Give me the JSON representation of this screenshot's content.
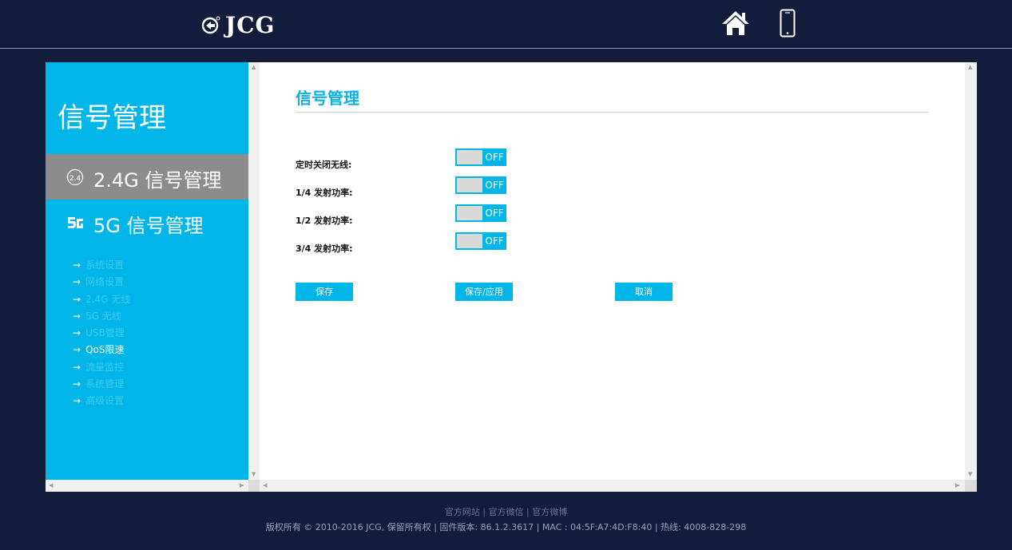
{
  "header": {
    "logo_text": "JCG",
    "logo_mark_icon": "jcg-compass-mark-icon",
    "home_icon": "home-icon",
    "phone_icon": "phone-icon"
  },
  "colors": {
    "background": "#111d3a",
    "accent": "#00b6e8",
    "sidebar_selected": "#8c8c8c",
    "toggle_off_knob": "#d9d9d9"
  },
  "sidebar": {
    "title": "信号管理",
    "item_24g": {
      "label": "2.4G 信号管理",
      "icon": "wifi-24-icon"
    },
    "item_5g": {
      "label": "5G 信号管理",
      "icon": "wifi-5g-icon"
    },
    "menu_arrow": "→",
    "menu": [
      {
        "label": "系统设置"
      },
      {
        "label": "网络设置"
      },
      {
        "label": "2.4G 无线"
      },
      {
        "label": "5G 无线"
      },
      {
        "label": "USB管理"
      },
      {
        "label": "QoS限速"
      },
      {
        "label": "流量监控"
      },
      {
        "label": "系统管理"
      },
      {
        "label": "高级设置"
      }
    ]
  },
  "main": {
    "title": "信号管理",
    "rows": [
      {
        "label": "定时关闭无线:",
        "state": "OFF"
      },
      {
        "label": "1/4 发射功率:",
        "state": "OFF"
      },
      {
        "label": "1/2 发射功率:",
        "state": "OFF"
      },
      {
        "label": "3/4 发射功率:",
        "state": "OFF"
      }
    ],
    "buttons": {
      "save": "保存",
      "save_apply": "保存/应用",
      "cancel": "取消"
    }
  },
  "footer": {
    "link_official_site": "官方网站",
    "link_wechat": "官方微信",
    "link_weibo": "官方微博",
    "separator": "|",
    "copyright_prefix": "版权所有",
    "copyright_main": "© 2010-2016 JCG,",
    "rights": "保留所有权",
    "firmware_label": "固件版本",
    "firmware_value": ": 86.1.2.3617",
    "mac": "MAC : 04:5F:A7:4D:F8:40",
    "hotline_label": "热线",
    "hotline_value": ": 4008-828-298"
  }
}
